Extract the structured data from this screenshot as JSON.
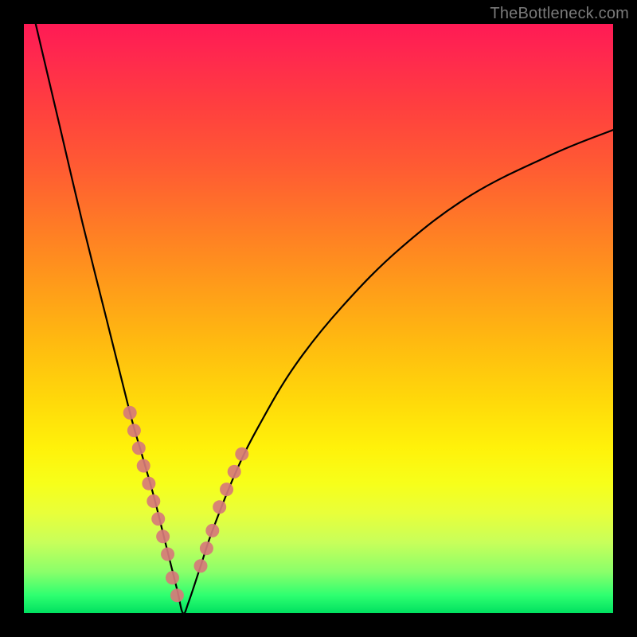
{
  "watermark": "TheBottleneck.com",
  "chart_data": {
    "type": "line",
    "title": "",
    "xlabel": "",
    "ylabel": "",
    "xlim": [
      0,
      100
    ],
    "ylim": [
      0,
      100
    ],
    "grid": false,
    "legend": false,
    "note": "Axes unlabeled in source image; values are relative percentages estimated from pixel positions. Minimum of the V-curve occurs around x≈27, y≈0.",
    "series": [
      {
        "name": "bottleneck-curve",
        "stroke": "#000000",
        "x": [
          2,
          6,
          10,
          14,
          18,
          20,
          22,
          24,
          26,
          27,
          28,
          30,
          32,
          36,
          40,
          46,
          54,
          64,
          76,
          90,
          100
        ],
        "y": [
          100,
          83,
          66,
          50,
          34,
          27,
          20,
          12,
          4,
          0,
          2,
          8,
          14,
          24,
          32,
          42,
          52,
          62,
          71,
          78,
          82
        ]
      },
      {
        "name": "data-points-left",
        "marker": "circle",
        "color": "#d67a7a",
        "x": [
          18.0,
          18.7,
          19.5,
          20.3,
          21.2,
          22.0,
          22.8,
          23.6,
          24.4,
          25.2,
          26.0
        ],
        "y": [
          34,
          31,
          28,
          25,
          22,
          19,
          16,
          13,
          10,
          6,
          3
        ]
      },
      {
        "name": "data-points-right",
        "marker": "circle",
        "color": "#d67a7a",
        "x": [
          30.0,
          31.0,
          32.0,
          33.2,
          34.4,
          35.7,
          37.0
        ],
        "y": [
          8,
          11,
          14,
          18,
          21,
          24,
          27
        ]
      }
    ]
  }
}
